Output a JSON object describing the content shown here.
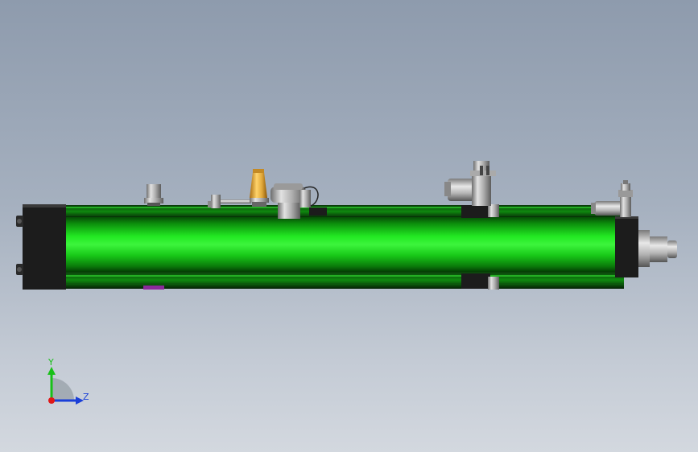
{
  "viewport": {
    "background_top": "#8e9bad",
    "background_bottom": "#d3d8df"
  },
  "model": {
    "cylinder_color": "#17d617",
    "cylinder_highlight": "#3cf53c",
    "cylinder_shadow": "#066b06",
    "cap_color": "#1c1c1c",
    "metal_color": "#b8b8b8",
    "brass_color": "#e0a83a"
  },
  "triad": {
    "y_label": "Y",
    "z_label": "Z",
    "y_color": "#18c018",
    "z_color": "#1a3fd8",
    "x_color": "#e01818"
  }
}
